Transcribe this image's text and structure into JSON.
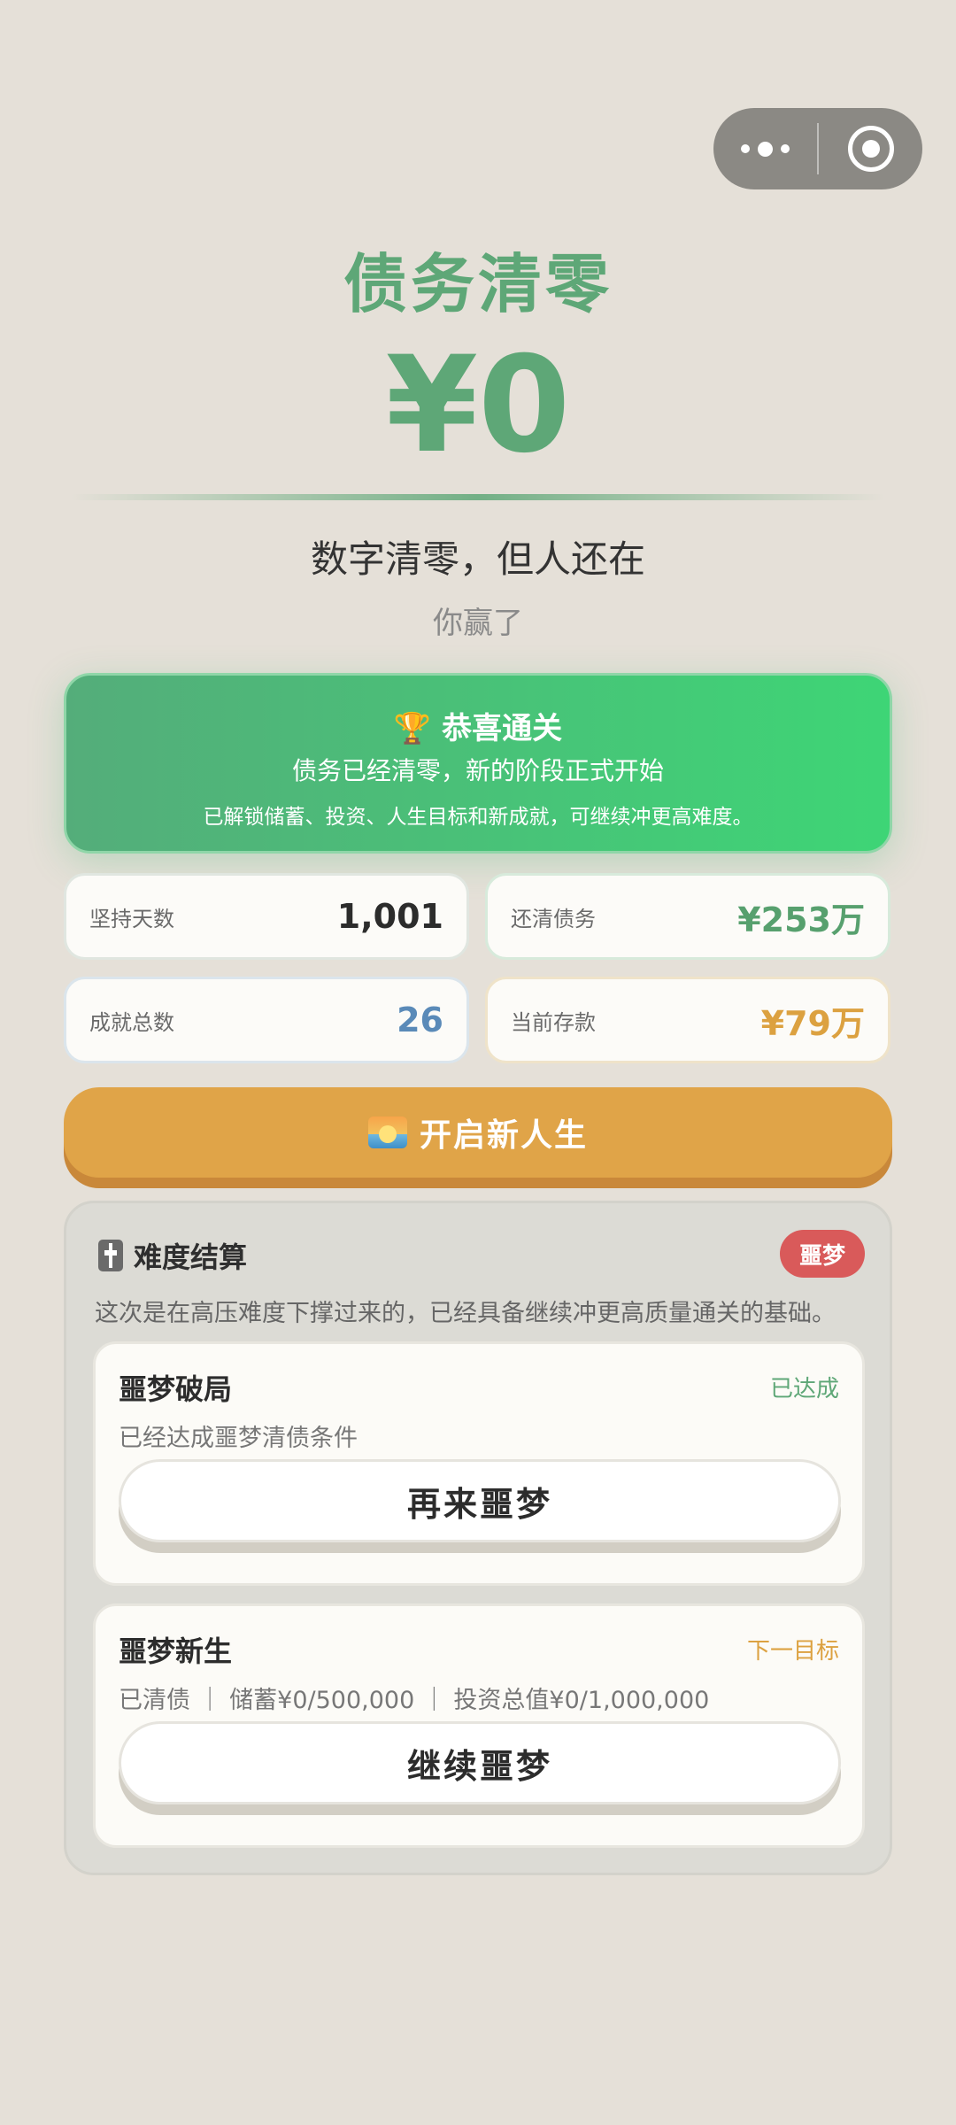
{
  "header": {
    "title": "债务清零",
    "amount": "¥0",
    "subtitle": "数字清零，但人还在",
    "status": "你赢了"
  },
  "congrats": {
    "icon": "🏆",
    "title": "恭喜通关",
    "line1": "债务已经清零，新的阶段正式开始",
    "line2": "已解锁储蓄、投资、人生目标和新成就，可继续冲更高难度。"
  },
  "stats": [
    {
      "label": "坚持天数",
      "value": "1,001"
    },
    {
      "label": "还清债务",
      "value": "¥253万"
    },
    {
      "label": "成就总数",
      "value": "26"
    },
    {
      "label": "当前存款",
      "value": "¥79万"
    }
  ],
  "new_life_button": {
    "icon": "sunrise-icon",
    "label": "开启新人生"
  },
  "difficulty": {
    "title": "难度结算",
    "icon": "slider-icon",
    "badge": "噩梦",
    "description": "这次是在高压难度下撑过来的，已经具备继续冲更高质量通关的基础。",
    "cards": [
      {
        "name": "噩梦破局",
        "status": "已达成",
        "info": "已经达成噩梦清债条件",
        "button": "再来噩梦"
      },
      {
        "name": "噩梦新生",
        "status": "下一目标",
        "info": "已清债 ｜ 储蓄¥0/500,000 ｜ 投资总值¥0/1,000,000",
        "button": "继续噩梦"
      }
    ]
  },
  "colors": {
    "background": "#e5e0d8",
    "accent_green": "#5ea777",
    "accent_orange": "#e0a448",
    "badge_red": "#d95a5a",
    "stat_blue": "#5a8ab8"
  }
}
